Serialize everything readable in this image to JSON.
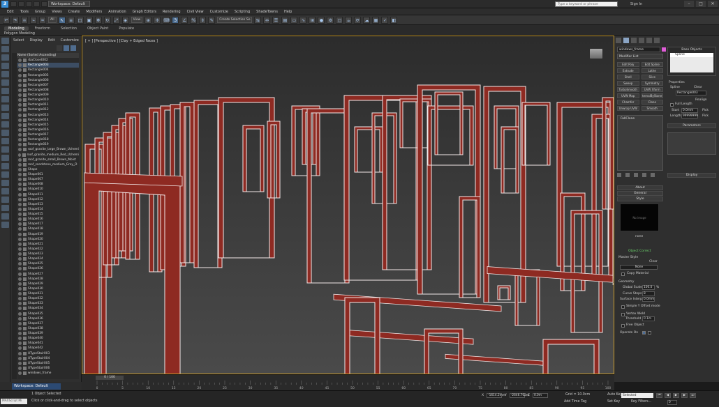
{
  "titlebar": {
    "workspace": "Workspace: Default",
    "search_placeholder": "Type a keyword or phrase",
    "sign_in": "Sign In",
    "minimize": "–",
    "maximize": "□",
    "close": "✕"
  },
  "menus": [
    "Edit",
    "Tools",
    "Group",
    "Views",
    "Create",
    "Modifiers",
    "Animation",
    "Graph Editors",
    "Rendering",
    "Civil View",
    "Customize",
    "Scripting",
    "ShadeTowns",
    "Help"
  ],
  "toolbar": {
    "filter_select": "All",
    "coord_select": "View",
    "selection_set": "Create Selection Se"
  },
  "ribbon": {
    "tabs": [
      "Modeling",
      "Freeform",
      "Selection",
      "Object Paint",
      "Populate"
    ],
    "active_tab": "Modeling",
    "subtitle": "Polygon Modeling"
  },
  "explorer": {
    "menu": [
      "Select",
      "Display",
      "Edit",
      "Customize"
    ],
    "header": "Name (Sorted Ascending)",
    "items": [
      "rbaCloset002",
      "Rectangle003",
      "Rectangle004",
      "Rectangle005",
      "Rectangle006",
      "Rectangle007",
      "Rectangle008",
      "Rectangle009",
      "Rectangle010",
      "Rectangle011",
      "Rectangle012",
      "Rectangle013",
      "Rectangle014",
      "Rectangle015",
      "Rectangle016",
      "Rectangle017",
      "Rectangle018",
      "Rectangle019",
      "roof_granite_large_Brown_Uchemi",
      "roof_granite_medium_Red_Uchemi",
      "roof_granite_small_Brown_Moist",
      "roof_sandstone_medium_Grey_D",
      "Shape",
      "Shape001",
      "Shape007",
      "Shape008",
      "Shape010",
      "Shape011",
      "Shape012",
      "Shape013",
      "Shape014",
      "Shape015",
      "Shape016",
      "Shape017",
      "Shape018",
      "Shape019",
      "Shape020",
      "Shape021",
      "Shape022",
      "Shape023",
      "Shape024",
      "Shape025",
      "Shape026",
      "Shape027",
      "Shape028",
      "Shape029",
      "Shape030",
      "Shape031",
      "Shape032",
      "Shape033",
      "Shape034",
      "Shape035",
      "Shape036",
      "Shape037",
      "Shape038",
      "Shape039",
      "Shape040",
      "Shape041",
      "Shape042",
      "UTypeStair003",
      "UTypeStair004",
      "UTypeStair005",
      "UTypeStair006",
      "windows_frame"
    ],
    "selected_index": 1
  },
  "viewport": {
    "label": "[ + ] [Perspective ] [Clay + Edged Faces ]"
  },
  "command_panel": {
    "object_name": "windows_frame",
    "object_color": "#e05cd8",
    "modifier_list": "Modifier List",
    "modifier_buttons": [
      "Edit Poly",
      "Edit Spline",
      "Extrude",
      "Lathe",
      "Shell",
      "Slice",
      "Sweep",
      "Symmetry",
      "TurboSmooth",
      "UVW Xform",
      "UVW Map",
      "ternalByStone",
      "Chamfer",
      "Clone",
      "Unwrap UVW",
      "Smooth"
    ],
    "stack_item": "FallClone",
    "base_objects_title": "Base Objects",
    "base_object": "Spline",
    "properties_title": "Properties",
    "spline_label": "Spline",
    "clear_label": "Clear",
    "rectangle_value": "Rectangle003",
    "realign_label": "Realign",
    "full_length_label": "Full Length",
    "start_label": "Start",
    "start_value": "0.0mm",
    "pick_label": "Pick",
    "length_label": "Length",
    "length_value": "99999999",
    "parameters_title": "Parameters",
    "display_title": "Display",
    "about_title": "About",
    "general_title": "General",
    "style_title": "Style",
    "no_image": "No image",
    "style_name": "none",
    "object_correct": "Object Correct",
    "master_style_label": "Master Style",
    "none_label": "None",
    "copy_material_label": "Copy Material",
    "geometry_title": "Geometry",
    "global_scale_label": "Global Scale",
    "global_scale_value": "100.0",
    "global_scale_unit": "%",
    "curve_steps_label": "Curve Steps",
    "curve_steps_value": "8",
    "surface_interp_label": "Surface Interp.",
    "surface_interp_value": "0.0mm",
    "simple_offset_label": "Simple Y Offset mode",
    "vertex_weld_label": "Vertex Weld",
    "threshold_label": "Threshold",
    "threshold_value": "0.1m",
    "free_object_label": "Free Object",
    "operate_on_label": "Operate On"
  },
  "bottom": {
    "workspace": "Workspace: Default",
    "time_slider": "0 / 100",
    "ruler_labels": [
      "0",
      "5",
      "10",
      "15",
      "20",
      "25",
      "30",
      "35",
      "40",
      "45",
      "50",
      "55",
      "60",
      "65",
      "70",
      "75",
      "80",
      "85",
      "90",
      "95",
      "100"
    ],
    "maxscript": "MAXScript Mi",
    "status_line1": "1 Object Selected",
    "status_line2": "Click or click-and-drag to select objects",
    "x_value": "-1614.2mm",
    "y_value": "-2646.762m",
    "z_value": "0.0m",
    "grid": "Grid = 10.0cm",
    "add_time_tag": "Add Time Tag",
    "auto_key": "Auto Key",
    "set_key": "Set Key",
    "selected_dropdown": "Selected",
    "key_filters": "Key Filters...",
    "frame_value": "0"
  }
}
